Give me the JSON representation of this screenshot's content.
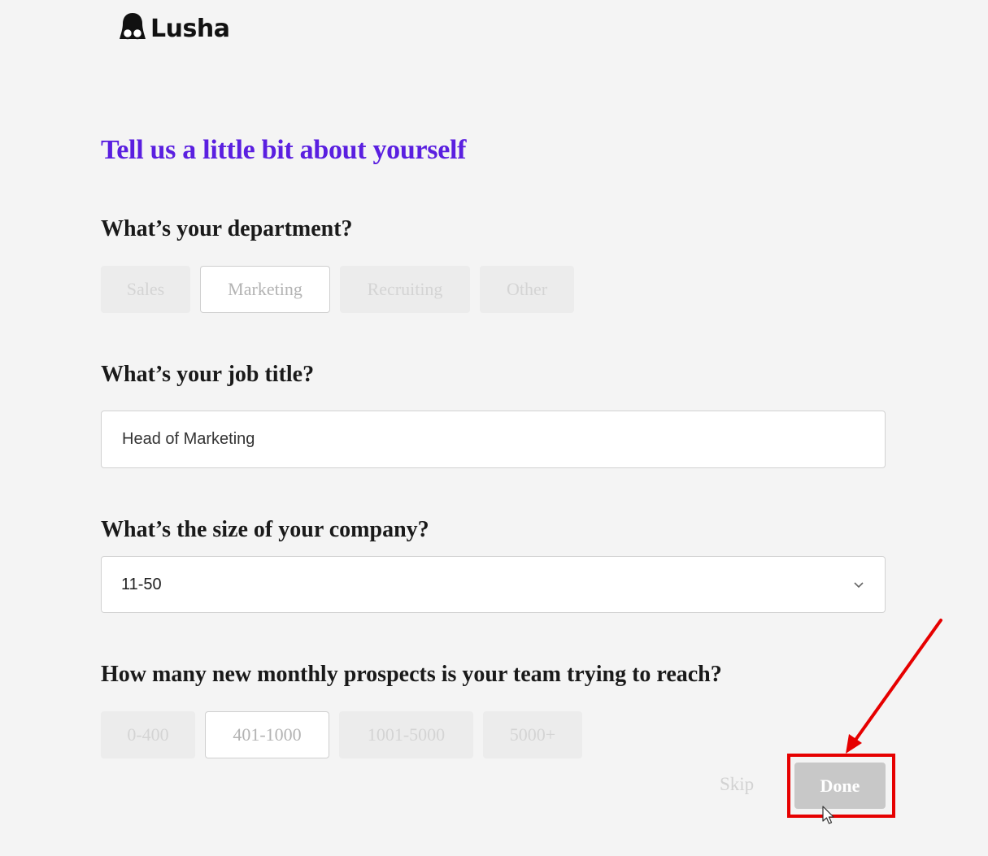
{
  "brand": {
    "name": "Lusha"
  },
  "headline": "Tell us a little bit about yourself",
  "department": {
    "question": "What’s your department?",
    "options": [
      "Sales",
      "Marketing",
      "Recruiting",
      "Other"
    ],
    "selected": "Marketing"
  },
  "job_title": {
    "question": "What’s your job title?",
    "value": "Head of Marketing"
  },
  "company_size": {
    "question": "What’s the size of your company?",
    "value": "11-50"
  },
  "prospects": {
    "question": "How many new monthly prospects is your team trying to reach?",
    "options": [
      "0-400",
      "401-1000",
      "1001-5000",
      "5000+"
    ],
    "selected": "401-1000"
  },
  "actions": {
    "skip_label": "Skip",
    "done_label": "Done"
  },
  "colors": {
    "headline": "#5a1fe0",
    "annotation": "#e60000",
    "done_button": "#c8c8c8"
  },
  "icons": {
    "logo": "lusha-glasses-logo-icon",
    "dropdown": "chevron-down-icon",
    "annotation": "red-arrow-icon",
    "pointer": "mouse-cursor-icon"
  }
}
